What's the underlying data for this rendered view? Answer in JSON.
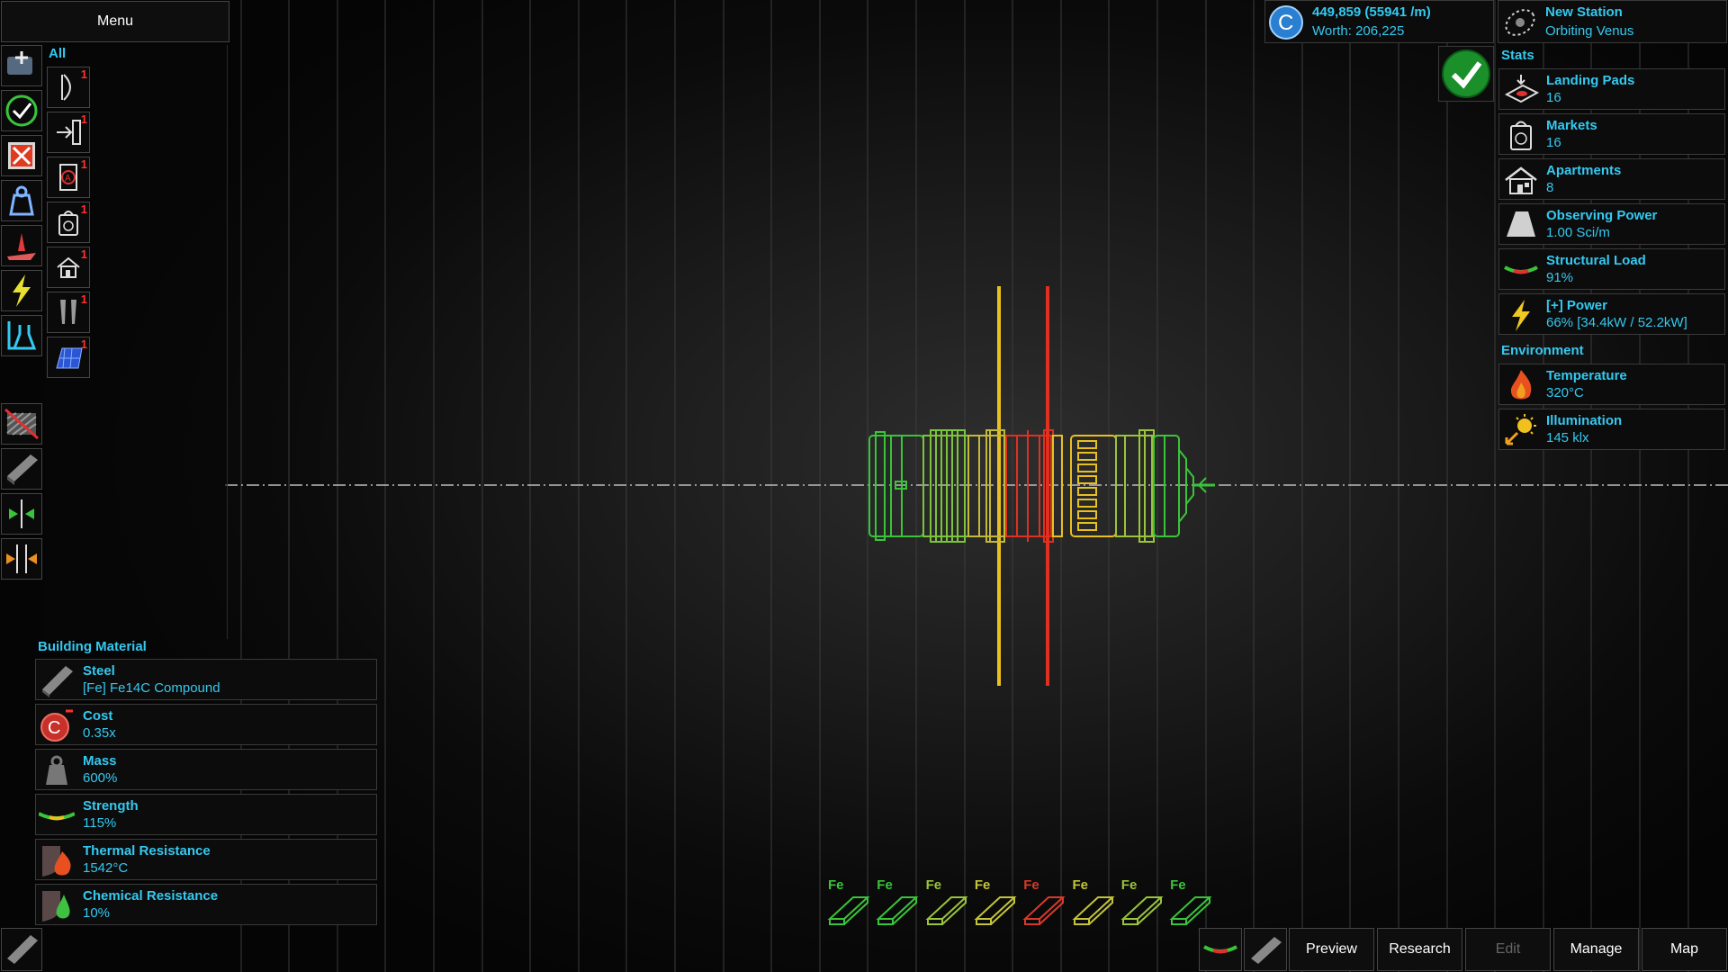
{
  "menu": {
    "label": "Menu"
  },
  "categories": {
    "all_label": "All",
    "items": [
      {
        "icon": "hull-curve-icon",
        "count": "1"
      },
      {
        "icon": "airlock-icon",
        "count": "1"
      },
      {
        "icon": "control-panel-icon",
        "count": "1"
      },
      {
        "icon": "market-bag-icon",
        "count": "1"
      },
      {
        "icon": "apartment-house-icon",
        "count": "1"
      },
      {
        "icon": "telescope-icon",
        "count": "1"
      },
      {
        "icon": "solar-panel-icon",
        "count": "1"
      }
    ]
  },
  "left_tools": [
    "add-module-icon",
    "check-icon",
    "delete-icon",
    "weight-icon",
    "heat-icon",
    "power-bolt-icon",
    "science-flask-icon",
    "hide-hatch-icon",
    "material-beam-icon",
    "expand-horizontal-icon",
    "mirror-icon"
  ],
  "header": {
    "money": "449,859 (55941 /m)",
    "worth": "Worth: 206,225",
    "station_name": "New Station",
    "station_orbit": "Orbiting Venus"
  },
  "stats": {
    "title": "Stats",
    "items": [
      {
        "label": "Landing Pads",
        "value": "16",
        "icon": "landing-pad-icon"
      },
      {
        "label": "Markets",
        "value": "16",
        "icon": "market-icon"
      },
      {
        "label": "Apartments",
        "value": "8",
        "icon": "apartment-icon"
      },
      {
        "label": "Observing Power",
        "value": "1.00 Sci/m",
        "icon": "observing-power-icon"
      },
      {
        "label": "Structural Load",
        "value": "91%",
        "icon": "structural-load-icon"
      },
      {
        "label": "[+] Power",
        "value": "66% [34.4kW / 52.2kW]",
        "icon": "power-icon"
      }
    ]
  },
  "environment": {
    "title": "Environment",
    "items": [
      {
        "label": "Temperature",
        "value": "320°C",
        "icon": "flame-icon"
      },
      {
        "label": "Illumination",
        "value": "145 klx",
        "icon": "sun-icon"
      }
    ]
  },
  "material": {
    "title": "Building Material",
    "items": [
      {
        "label": "Steel",
        "value": "[Fe] Fe14C Compound",
        "icon": "steel-beam-icon"
      },
      {
        "label": "Cost",
        "value": "0.35x",
        "icon": "cost-coin-icon"
      },
      {
        "label": "Mass",
        "value": "600%",
        "icon": "mass-weight-icon"
      },
      {
        "label": "Strength",
        "value": "115%",
        "icon": "strength-icon"
      },
      {
        "label": "Thermal Resistance",
        "value": "1542°C",
        "icon": "thermal-resistance-icon"
      },
      {
        "label": "Chemical Resistance",
        "value": "10%",
        "icon": "chemical-resistance-icon"
      }
    ]
  },
  "segments": [
    {
      "label": "Fe",
      "color": "#3ac43a"
    },
    {
      "label": "Fe",
      "color": "#3ac43a"
    },
    {
      "label": "Fe",
      "color": "#9ac43a"
    },
    {
      "label": "Fe",
      "color": "#c4c43a"
    },
    {
      "label": "Fe",
      "color": "#d83a2a"
    },
    {
      "label": "Fe",
      "color": "#c4c43a"
    },
    {
      "label": "Fe",
      "color": "#9ac43a"
    },
    {
      "label": "Fe",
      "color": "#3ac43a"
    }
  ],
  "bottom_bar": {
    "preview": "Preview",
    "research": "Research",
    "edit": "Edit",
    "manage": "Manage",
    "map": "Map"
  },
  "colors": {
    "accent": "#34c9f0",
    "badge": "#ff3030",
    "green": "#3ac43a",
    "yellow": "#e8c020",
    "red": "#e03020"
  }
}
